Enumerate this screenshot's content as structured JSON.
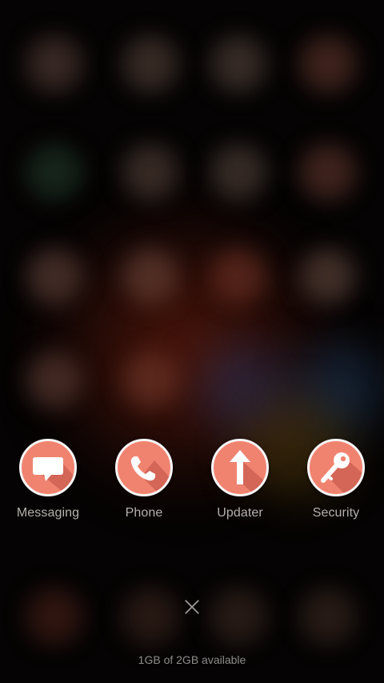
{
  "dock": {
    "apps": [
      {
        "label": "Messaging",
        "icon": "message-bubble-icon"
      },
      {
        "label": "Phone",
        "icon": "phone-handset-icon"
      },
      {
        "label": "Updater",
        "icon": "up-arrow-icon"
      },
      {
        "label": "Security",
        "icon": "key-icon"
      }
    ]
  },
  "close": {
    "icon": "close-icon"
  },
  "memory": {
    "text": "1GB of 2GB available"
  },
  "colors": {
    "icon_fill": "#f08370",
    "icon_border": "#f7f7f7",
    "label": "#b5b0ad",
    "background": "#050303"
  }
}
